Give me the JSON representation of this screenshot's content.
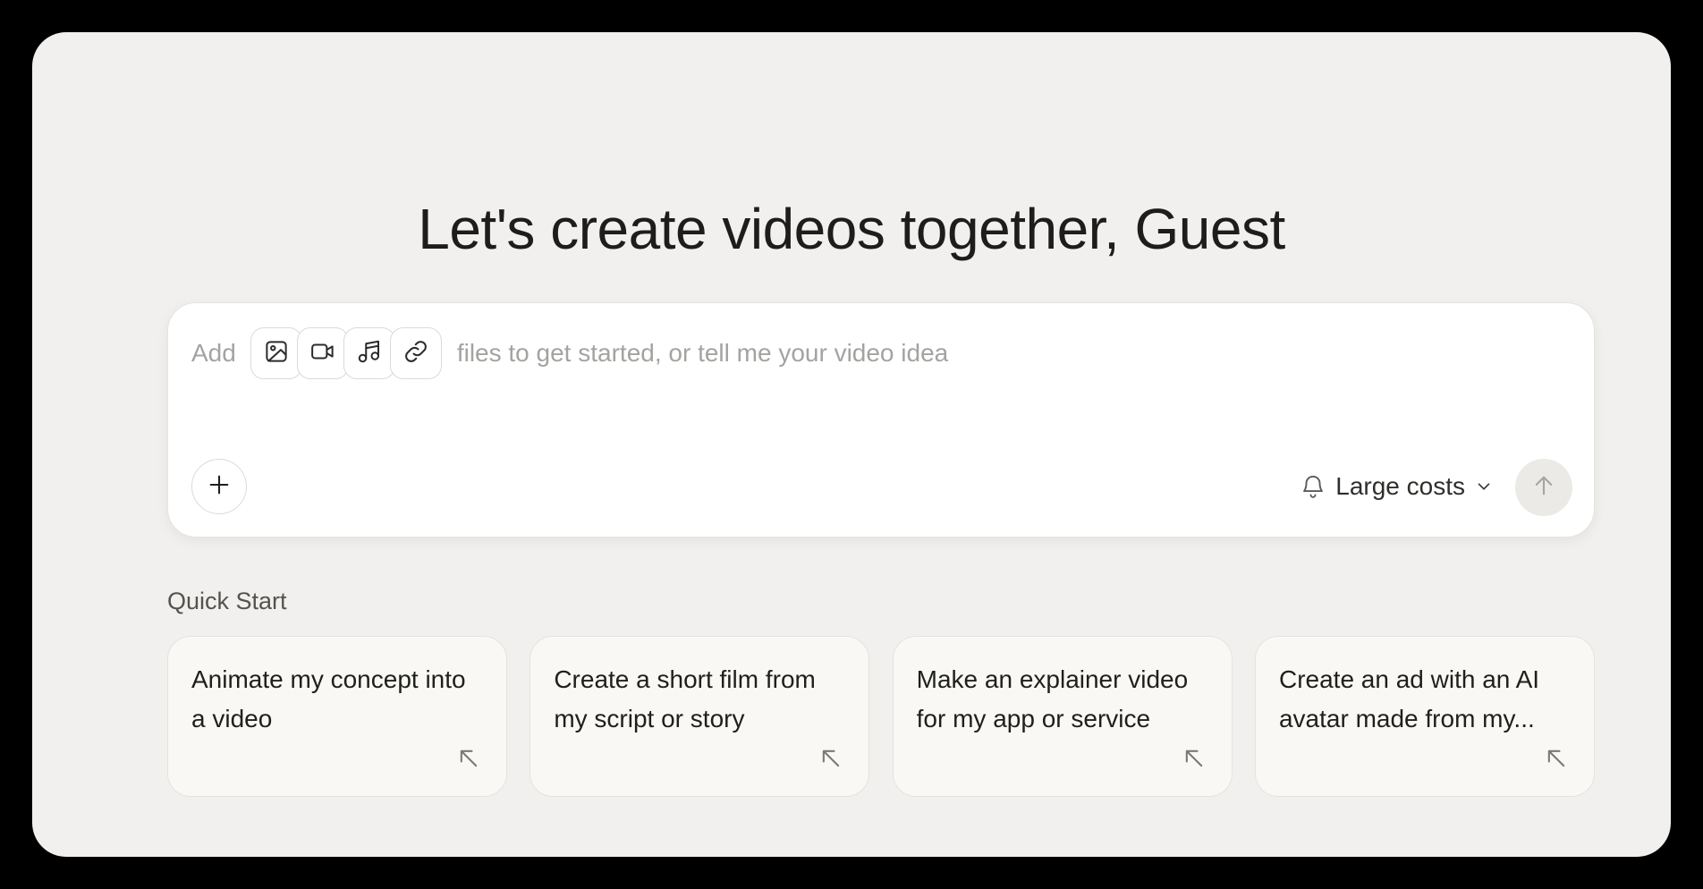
{
  "heading": "Let's create videos together, Guest",
  "composer": {
    "prefix": "Add",
    "placeholder": "files to get started, or tell me your video idea",
    "attachments": [
      {
        "icon": "image-icon"
      },
      {
        "icon": "video-camera-icon"
      },
      {
        "icon": "music-note-icon"
      },
      {
        "icon": "link-icon"
      }
    ],
    "plus_icon": "plus-icon",
    "cost_mode": {
      "icon": "bell-icon",
      "label": "Large costs"
    },
    "send_icon": "arrow-up-icon"
  },
  "quick_start": {
    "label": "Quick Start",
    "cards": [
      {
        "text": "Animate my concept into a video",
        "icon": "arrow-up-left-icon"
      },
      {
        "text": "Create a short film from my script or story",
        "icon": "arrow-up-left-icon"
      },
      {
        "text": "Make an explainer video for my app or service",
        "icon": "arrow-up-left-icon"
      },
      {
        "text": "Create an ad with an AI avatar made from my...",
        "icon": "arrow-up-left-icon"
      }
    ]
  },
  "colors": {
    "background": "#000000",
    "panel": "#f1f0ee",
    "card": "#f9f8f5",
    "placeholder": "#a3a3a0",
    "text": "#1d1d1b"
  }
}
